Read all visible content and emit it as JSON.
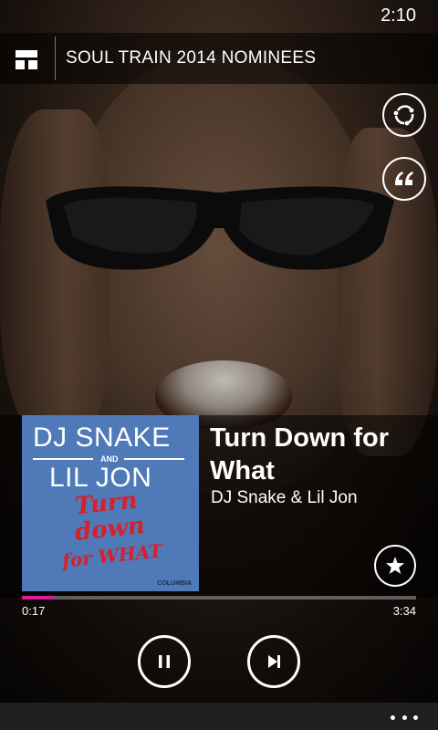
{
  "status_bar": {
    "time": "2:10"
  },
  "header": {
    "title": "SOUL TRAIN 2014 NOMINEES",
    "menu_icon": "layout-icon"
  },
  "actions": {
    "sync_icon": "sync-icon",
    "quote_icon": "quote-icon",
    "favorite_icon": "star-icon"
  },
  "now_playing": {
    "title": "Turn Down for What",
    "artist": "DJ Snake & Lil Jon",
    "cover": {
      "line1": "DJ SNAKE",
      "connector": "AND",
      "line2": "LIL JON",
      "script1": "Turn",
      "script2": "down",
      "script3": "for WHAT",
      "label": "COLUMBIA"
    },
    "elapsed": "0:17",
    "duration": "3:34",
    "progress": 0.08
  },
  "controls": {
    "pause_icon": "pause-icon",
    "next_icon": "skip-next-icon"
  },
  "app_bar": {
    "more_icon": "more-icon"
  },
  "colors": {
    "accent": "#e0189b",
    "cover_bg": "#4f79b7",
    "cover_red": "#d81f2a"
  }
}
